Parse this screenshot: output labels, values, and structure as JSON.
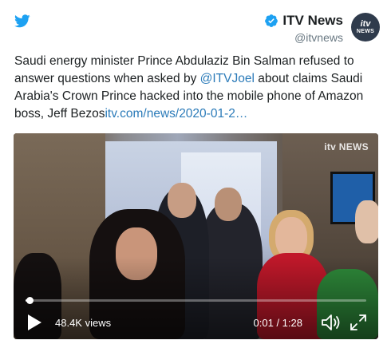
{
  "author": {
    "name": "ITV News",
    "handle": "@itvnews",
    "avatar_line1": "itv",
    "avatar_line2": "NEWS",
    "verified": true
  },
  "tweet": {
    "text_before_mention": "Saudi energy minister Prince Abdulaziz Bin Salman refused to answer questions when asked by ",
    "mention": "@ITVJoel",
    "text_after_mention": " about claims Saudi Arabia's Crown Prince hacked into the mobile phone of Amazon boss, Jeff Bezos",
    "link": "itv.com/news/2020-01-2…"
  },
  "video": {
    "watermark": "itv NEWS",
    "views": "48.4K views",
    "time": "0:01 / 1:28",
    "progress_fraction": 0.012
  },
  "icons": {
    "twitter": "twitter-bird-icon",
    "verified": "verified-badge-icon",
    "play": "play-icon",
    "volume": "volume-icon",
    "expand": "expand-icon"
  },
  "colors": {
    "twitter_blue": "#1da1f2",
    "link_blue": "#2b7bb9",
    "verified_blue": "#1da1f2",
    "text": "#1c2022",
    "muted": "#697882"
  }
}
